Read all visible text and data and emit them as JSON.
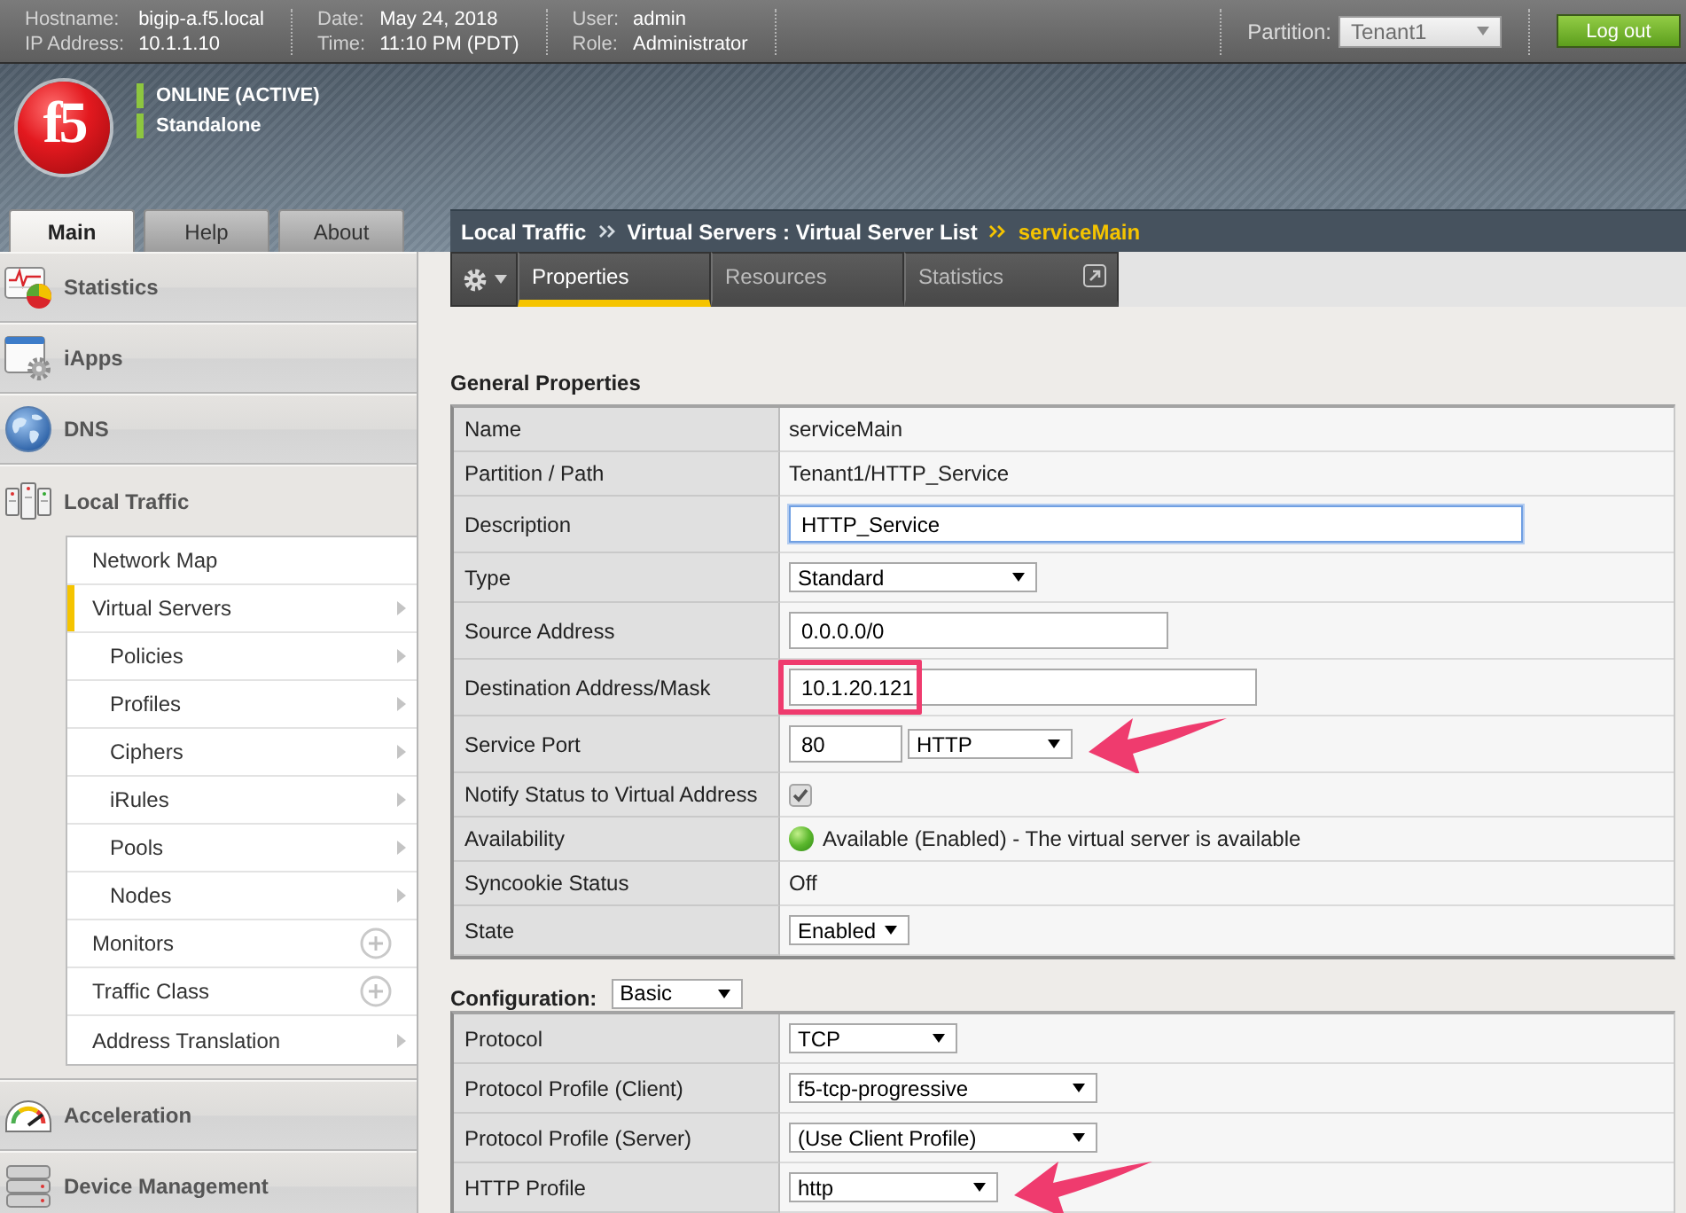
{
  "top_bar": {
    "info_groups": [
      {
        "items": [
          {
            "label": "Hostname:",
            "value": "bigip-a.f5.local"
          },
          {
            "label": "IP Address:",
            "value": "10.1.1.10"
          }
        ]
      },
      {
        "items": [
          {
            "label": "Date:",
            "value": "May 24, 2018"
          },
          {
            "label": "Time:",
            "value": "11:10 PM (PDT)"
          }
        ]
      },
      {
        "items": [
          {
            "label": "User:",
            "value": "admin"
          },
          {
            "label": "Role:",
            "value": "Administrator"
          }
        ]
      }
    ],
    "partition": {
      "label": "Partition:",
      "value": "Tenant1"
    },
    "logout_button": "Log out"
  },
  "header": {
    "logo": "f5",
    "status": [
      "ONLINE (ACTIVE)",
      "Standalone"
    ]
  },
  "nav_tabs": [
    {
      "label": "Main",
      "selected": true
    },
    {
      "label": "Help",
      "selected": false
    },
    {
      "label": "About",
      "selected": false
    }
  ],
  "sidebar": {
    "sections": [
      {
        "label": "Statistics",
        "expanded": false
      },
      {
        "label": "iApps",
        "expanded": false
      },
      {
        "label": "DNS",
        "expanded": false
      },
      {
        "label": "Local Traffic",
        "expanded": true,
        "items": [
          {
            "label": "Network Map",
            "kind": "link",
            "selected": false
          },
          {
            "label": "Virtual Servers",
            "kind": "menu",
            "selected": true,
            "children": [
              {
                "label": "Policies",
                "kind": "menu",
                "selected": false
              },
              {
                "label": "Profiles",
                "kind": "menu",
                "selected": false
              },
              {
                "label": "Ciphers",
                "kind": "menu",
                "selected": false
              },
              {
                "label": "iRules",
                "kind": "menu",
                "selected": false
              },
              {
                "label": "Pools",
                "kind": "menu",
                "selected": false
              },
              {
                "label": "Nodes",
                "kind": "menu",
                "selected": false
              }
            ]
          },
          {
            "label": "Monitors",
            "kind": "create",
            "selected": false
          },
          {
            "label": "Traffic Class",
            "kind": "create",
            "selected": false
          },
          {
            "label": "Address Translation",
            "kind": "menu",
            "selected": false
          }
        ]
      },
      {
        "label": "Acceleration",
        "expanded": false
      },
      {
        "label": "Device Management",
        "expanded": false
      }
    ]
  },
  "breadcrumb": {
    "items": [
      {
        "label": "Local Traffic",
        "current": false
      },
      {
        "label": "Virtual Servers : Virtual Server List",
        "current": false
      },
      {
        "label": "serviceMain",
        "current": true
      }
    ]
  },
  "page_tabs": [
    {
      "label": "Properties",
      "selected": true
    },
    {
      "label": "Resources",
      "selected": false
    },
    {
      "label": "Statistics",
      "selected": false,
      "popout": true
    }
  ],
  "general_properties": {
    "title": "General Properties",
    "rows": [
      {
        "kind": "text",
        "label": "Name",
        "value": "serviceMain",
        "highlighted": false,
        "arrow": false
      },
      {
        "kind": "text",
        "label": "Partition / Path",
        "value": "Tenant1/HTTP_Service",
        "highlighted": false,
        "arrow": false
      },
      {
        "kind": "input",
        "label": "Description",
        "value": "HTTP_Service",
        "focused": true,
        "highlighted": false,
        "arrow": false
      },
      {
        "kind": "select",
        "label": "Type",
        "value": "Standard",
        "highlighted": false,
        "arrow": false
      },
      {
        "kind": "input",
        "label": "Source Address",
        "value": "0.0.0.0/0",
        "focused": false,
        "highlighted": false,
        "arrow": false
      },
      {
        "kind": "input",
        "label": "Destination Address/Mask",
        "value": "10.1.20.121",
        "focused": false,
        "highlighted": true,
        "arrow": false
      },
      {
        "kind": "port",
        "label": "Service Port",
        "value": "80",
        "protocol": "HTTP",
        "highlighted": false,
        "arrow": true
      },
      {
        "kind": "checkbox",
        "label": "Notify Status to Virtual Address",
        "checked": true,
        "highlighted": false,
        "arrow": false
      },
      {
        "kind": "status",
        "label": "Availability",
        "value": "Available (Enabled) - The virtual server is available",
        "highlighted": false,
        "arrow": false
      },
      {
        "kind": "text",
        "label": "Syncookie Status",
        "value": "Off",
        "highlighted": false,
        "arrow": false
      },
      {
        "kind": "select",
        "label": "State",
        "value": "Enabled",
        "highlighted": false,
        "arrow": false
      }
    ]
  },
  "configuration": {
    "title": "Configuration:",
    "mode": "Basic",
    "rows": [
      {
        "kind": "select",
        "label": "Protocol",
        "value": "TCP",
        "highlighted": false,
        "arrow": false
      },
      {
        "kind": "select",
        "label": "Protocol Profile (Client)",
        "value": "f5-tcp-progressive",
        "highlighted": false,
        "arrow": false
      },
      {
        "kind": "select",
        "label": "Protocol Profile (Server)",
        "value": "(Use Client Profile)",
        "highlighted": false,
        "arrow": false
      },
      {
        "kind": "select",
        "label": "HTTP Profile",
        "value": "http",
        "highlighted": false,
        "arrow": true
      }
    ]
  }
}
